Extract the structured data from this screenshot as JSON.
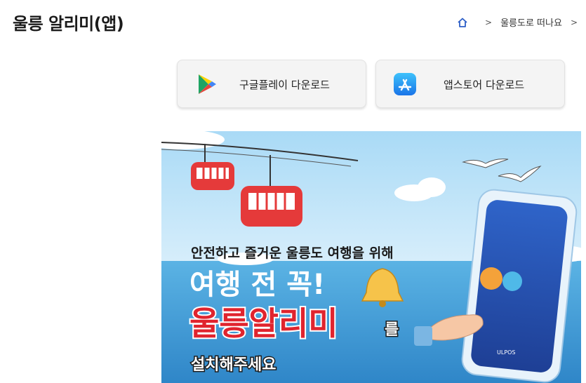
{
  "page": {
    "title": "울릉 알리미(앱)"
  },
  "breadcrumb": {
    "home_icon": "home-icon",
    "current": "울릉도로 떠나요"
  },
  "buttons": {
    "google_play": {
      "label": "구글플레이 다운로드",
      "icon": "google-play-icon"
    },
    "app_store": {
      "label": "앱스토어 다운로드",
      "icon": "app-store-icon"
    }
  },
  "banner": {
    "subtitle": "안전하고 즐거운 울릉도 여행을 위해",
    "headline": "여행 전 꼭!",
    "app_name": "울릉알리미",
    "particle": "를",
    "cta": "설치해주세요",
    "phone_logo": "ULPOS",
    "colors": {
      "sky": "#bfe3f7",
      "sea": "#49a6dc",
      "accent_red": "#e0242e",
      "phone": "#2c58b8"
    }
  }
}
